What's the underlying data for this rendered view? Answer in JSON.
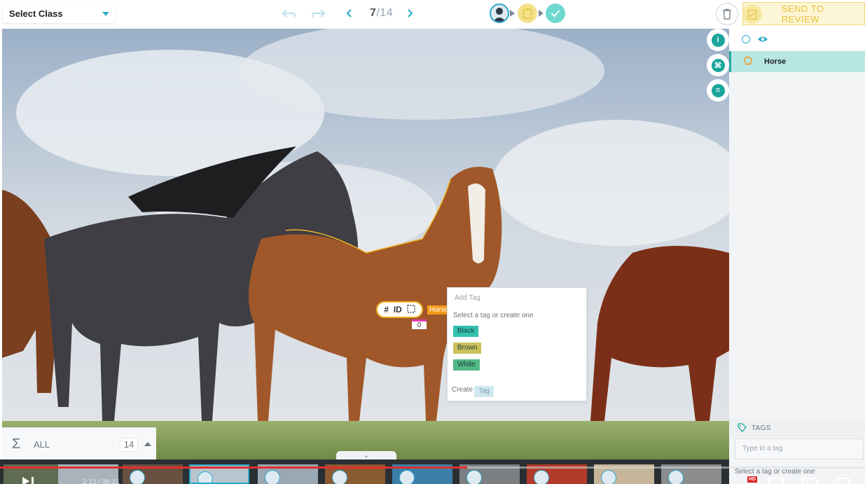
{
  "toolbar": {
    "class_select": "Select Class",
    "page_current": "7",
    "page_total": "/14",
    "send_to_review": "SEND TO REVIEW"
  },
  "annotation": {
    "tool_id": "ID",
    "object_label": "Horse",
    "count": "0"
  },
  "tag_popup": {
    "title": "Add Tag",
    "hint": "Select a tag or create one",
    "tags": [
      {
        "label": "Black",
        "color": "#33c2b0"
      },
      {
        "label": "Brown",
        "color": "#c9c15a"
      },
      {
        "label": "White",
        "color": "#52b884"
      }
    ],
    "create_label": "Create",
    "tag_button": "Tag"
  },
  "stats": {
    "filter": "ALL",
    "count": "14"
  },
  "sidebar": {
    "objects": [
      {
        "label": "Horse"
      }
    ],
    "tags_header": "TAGS",
    "tags_placeholder": "Type in a tag",
    "tags_hint": "Select a tag or create one"
  },
  "video": {
    "time": "2:13 / 36:21",
    "quality_badge": "HD",
    "progress_fraction": 0.54
  },
  "colors": {
    "accent": "#2aa9c9",
    "label_orange": "#f29a18",
    "review_yellow": "#f0d77a",
    "selected_row": "#b8e6e3"
  }
}
